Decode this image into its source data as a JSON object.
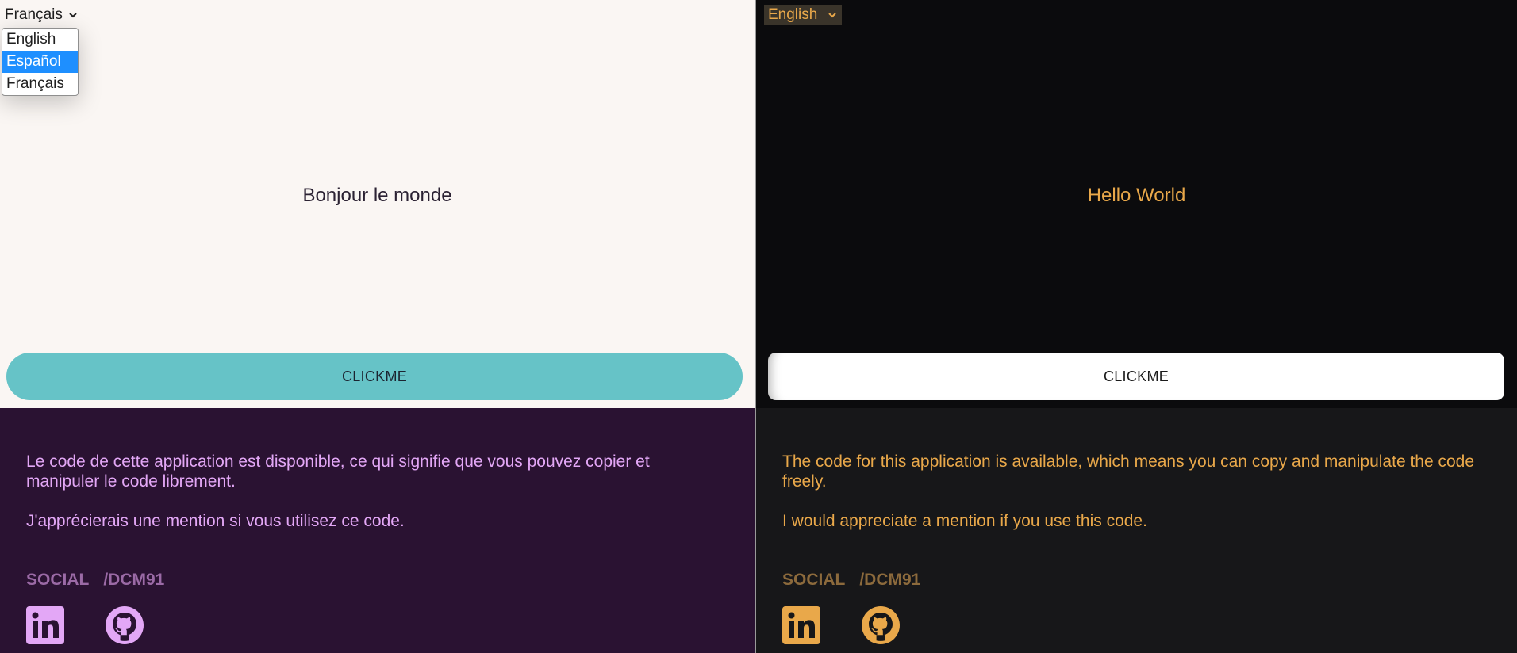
{
  "left": {
    "select_value": "Français",
    "dropdown_options": [
      "English",
      "Español",
      "Français"
    ],
    "greeting": "Bonjour le monde",
    "button_label": "CLICKME",
    "footer_para1": "Le code de cette application est disponible, ce qui signifie que vous pouvez copier et manipuler le code librement.",
    "footer_para2": "J'apprécierais une mention si vous utilisez ce code.",
    "social_label": "SOCIAL",
    "handle": "/DCM91",
    "icons": [
      "linkedin-icon",
      "github-icon"
    ],
    "colors": {
      "background": "#faf6f3",
      "button": "#66c3c7",
      "footer": "#2a1232",
      "footer_text": "#e3a7f6",
      "highlight": "#1e8fff"
    }
  },
  "right": {
    "select_value": "English",
    "greeting": "Hello World",
    "button_label": "CLICKME",
    "footer_para1": "The code for this application is available, which means you can copy and manipulate the code freely.",
    "footer_para2": "I would appreciate a mention if you use this code.",
    "social_label": "SOCIAL",
    "handle": "/DCM91",
    "icons": [
      "linkedin-icon",
      "github-icon"
    ],
    "colors": {
      "background": "#0b0b0d",
      "accent": "#e9a84a",
      "button": "#ffffff",
      "footer": "#171719"
    }
  }
}
